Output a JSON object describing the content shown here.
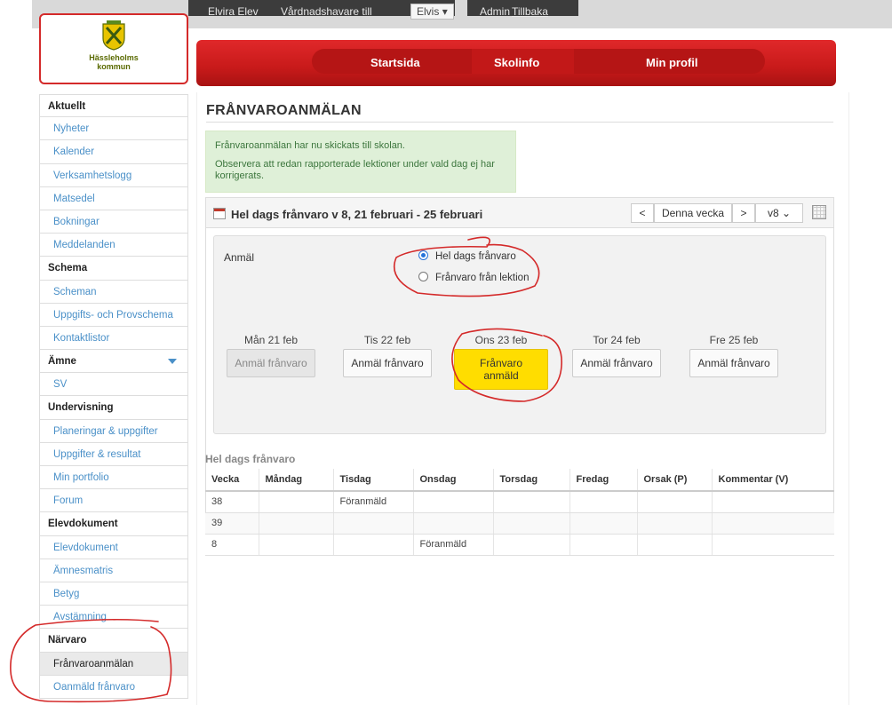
{
  "topbar": {
    "user": "Elvira Elev",
    "guardian_label": "Vårdnadshavare till",
    "guardian_select": "Elvis",
    "admin": "Admin",
    "back": "Tillbaka"
  },
  "logo": {
    "line1": "Hässleholms",
    "line2": "kommun"
  },
  "nav": {
    "items": [
      "Startsida",
      "Skolinfo",
      "Min profil"
    ]
  },
  "sidebar": {
    "sections": [
      {
        "head": "Aktuellt",
        "items": [
          "Nyheter",
          "Kalender",
          "Verksamhetslogg",
          "Matsedel",
          "Bokningar",
          "Meddelanden"
        ]
      },
      {
        "head": "Schema",
        "items": [
          "Scheman",
          "Uppgifts- och Provschema",
          "Kontaktlistor"
        ]
      },
      {
        "head": "Ämne",
        "items": [
          "SV"
        ]
      },
      {
        "head": "Undervisning",
        "items": [
          "Planeringar & uppgifter",
          "Uppgifter & resultat",
          "Min portfolio",
          "Forum"
        ]
      },
      {
        "head": "Elevdokument",
        "items": [
          "Elevdokument",
          "Ämnesmatris",
          "Betyg",
          "Avstämning"
        ]
      },
      {
        "head": "Närvaro",
        "items": [
          "Frånvaroanmälan",
          "Oanmäld frånvaro"
        ]
      }
    ]
  },
  "page": {
    "title": "FRÅNVAROANMÄLAN",
    "message_1": "Frånvaroanmälan har nu skickats till skolan.",
    "message_2": "Observera att redan rapporterade lektioner under vald dag ej har korrigerats.",
    "panel_title": "Hel dags frånvaro v 8, 21 februari - 25 februari",
    "prev": "<",
    "this_week": "Denna vecka",
    "next": ">",
    "week_select": "v8",
    "anmal_label": "Anmäl",
    "radio_full_day": "Hel dags frånvaro",
    "radio_lesson": "Frånvaro från lektion",
    "days": [
      {
        "label": "Mån 21 feb",
        "button": "Anmäl frånvaro"
      },
      {
        "label": "Tis 22 feb",
        "button": "Anmäl frånvaro"
      },
      {
        "label": "Ons 23 feb",
        "button": "Frånvaro anmäld"
      },
      {
        "label": "Tor 24 feb",
        "button": "Anmäl frånvaro"
      },
      {
        "label": "Fre 25 feb",
        "button": "Anmäl frånvaro"
      }
    ],
    "table_title": "Hel dags frånvaro",
    "columns": [
      "Vecka",
      "Måndag",
      "Tisdag",
      "Onsdag",
      "Torsdag",
      "Fredag",
      "Orsak (P)",
      "Kommentar (V)"
    ],
    "rows": [
      [
        "38",
        "",
        "Föranmäld",
        "",
        "",
        "",
        "",
        ""
      ],
      [
        "39",
        "",
        "",
        "",
        "",
        "",
        "",
        ""
      ],
      [
        "8",
        "",
        "",
        "Föranmäld",
        "",
        "",
        "",
        ""
      ]
    ]
  },
  "colors": {
    "nav_red": "#c81a1a",
    "success_bg": "#dff0d8",
    "reported_yellow": "#ffdd00",
    "link_blue": "#4a90c8",
    "annotation_red": "#d42a2a"
  }
}
